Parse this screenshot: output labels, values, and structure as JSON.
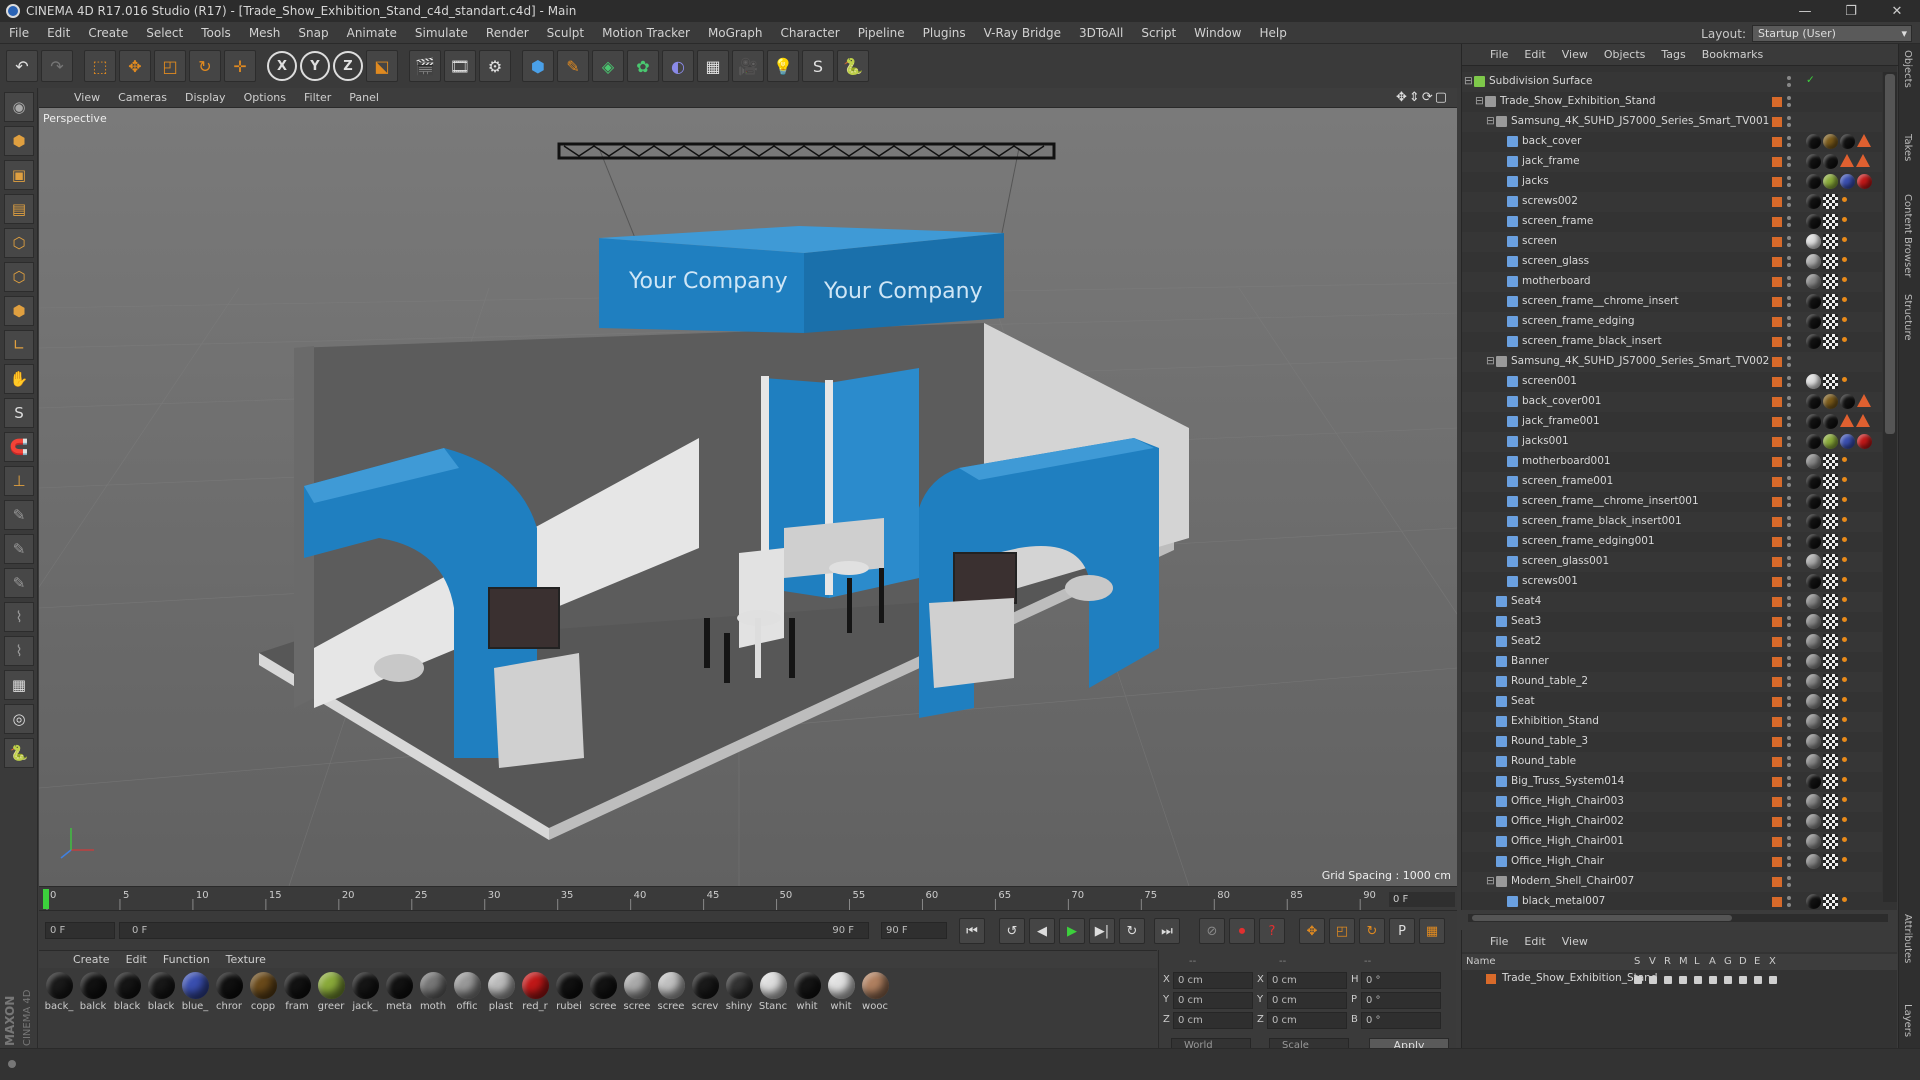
{
  "window": {
    "title": "CINEMA 4D R17.016 Studio (R17) - [Trade_Show_Exhibition_Stand_c4d_standart.c4d] - Main"
  },
  "menubar": [
    "File",
    "Edit",
    "Create",
    "Select",
    "Tools",
    "Mesh",
    "Snap",
    "Animate",
    "Simulate",
    "Render",
    "Sculpt",
    "Motion Tracker",
    "MoGraph",
    "Character",
    "Pipeline",
    "Plugins",
    "V-Ray Bridge",
    "3DToAll",
    "Script",
    "Window",
    "Help"
  ],
  "layout": {
    "label": "Layout:",
    "value": "Startup (User)"
  },
  "toolbar": {
    "icons": [
      "undo-icon",
      "redo-icon",
      "live-selection-icon",
      "move-icon",
      "scale-icon",
      "rotate-icon",
      "last-tool-icon",
      "x-axis-icon",
      "y-axis-icon",
      "z-axis-icon",
      "coordinate-system-icon",
      "render-view-icon",
      "render-picture-viewer-icon",
      "edit-render-settings-icon",
      "cube-icon",
      "pen-spline-icon",
      "subdivision-icon",
      "array-icon",
      "deformer-icon",
      "floor-icon",
      "camera-icon",
      "light-icon",
      "xpresso-icon",
      "python-icon"
    ],
    "axis_labels": [
      "X",
      "Y",
      "Z"
    ]
  },
  "viewport": {
    "menu": [
      "View",
      "Cameras",
      "Display",
      "Options",
      "Filter",
      "Panel"
    ],
    "label": "Perspective",
    "grid_spacing": "Grid Spacing : 1000 cm",
    "banner_text": "Your Company"
  },
  "timeline": {
    "ticks": [
      "0",
      "5",
      "10",
      "15",
      "20",
      "25",
      "30",
      "35",
      "40",
      "45",
      "50",
      "55",
      "60",
      "65",
      "70",
      "75",
      "80",
      "85",
      "90"
    ],
    "frame_end_field": "0 F"
  },
  "transport": {
    "current_frame": "0 F",
    "range_start": "0 F",
    "range_end": "90 F",
    "max_frame": "90 F"
  },
  "materials": {
    "menu": [
      "Create",
      "Edit",
      "Function",
      "Texture"
    ],
    "items": [
      {
        "name": "back_",
        "color": "#1a1a1a"
      },
      {
        "name": "balck",
        "color": "#111111"
      },
      {
        "name": "black",
        "color": "#151515"
      },
      {
        "name": "black",
        "color": "#181818"
      },
      {
        "name": "blue_",
        "color": "#3a4fb0"
      },
      {
        "name": "chror",
        "color": "#101010"
      },
      {
        "name": "copp",
        "color": "#6a4a1a"
      },
      {
        "name": "fram",
        "color": "#121212"
      },
      {
        "name": "greer",
        "color": "#8aaa3a"
      },
      {
        "name": "jack_",
        "color": "#151515"
      },
      {
        "name": "meta",
        "color": "#121212"
      },
      {
        "name": "moth",
        "color": "#777777"
      },
      {
        "name": "offic",
        "color": "#999999"
      },
      {
        "name": "plast",
        "color": "#bbbbbb"
      },
      {
        "name": "red_r",
        "color": "#c01818"
      },
      {
        "name": "rubei",
        "color": "#111111"
      },
      {
        "name": "scree",
        "color": "#131313"
      },
      {
        "name": "scree",
        "color": "#aaaaaa"
      },
      {
        "name": "scree",
        "color": "#c0c0c0"
      },
      {
        "name": "screv",
        "color": "#1a1a1a"
      },
      {
        "name": "shiny",
        "color": "#333333"
      },
      {
        "name": "Stanc",
        "color": "#dddddd"
      },
      {
        "name": "whit",
        "color": "#151515"
      },
      {
        "name": "whit",
        "color": "#e0e0e0"
      },
      {
        "name": "wooc",
        "color": "#b08060"
      }
    ]
  },
  "coords": {
    "header": [
      "--",
      "--",
      "--"
    ],
    "rows": [
      {
        "a": "X",
        "av": "0 cm",
        "b": "X",
        "bv": "0 cm",
        "c": "H",
        "cv": "0 °"
      },
      {
        "a": "Y",
        "av": "0 cm",
        "b": "Y",
        "bv": "0 cm",
        "c": "P",
        "cv": "0 °"
      },
      {
        "a": "Z",
        "av": "0 cm",
        "b": "Z",
        "bv": "0 cm",
        "c": "B",
        "cv": "0 °"
      }
    ],
    "mode": "World",
    "scale": "Scale",
    "apply": "Apply"
  },
  "objects": {
    "menu": [
      "File",
      "Edit",
      "View",
      "Objects",
      "Tags",
      "Bookmarks"
    ],
    "items": [
      {
        "name": "Subdivision Surface",
        "indent": 0,
        "icon": "#7ec84a",
        "tags": "sub"
      },
      {
        "name": "Trade_Show_Exhibition_Stand",
        "indent": 1,
        "icon": "#999",
        "tags": ""
      },
      {
        "name": "Samsung_4K_SUHD_JS7000_Series_Smart_TV001",
        "indent": 2,
        "icon": "#999",
        "tags": ""
      },
      {
        "name": "back_cover",
        "indent": 3,
        "icon": "#6aa0e0",
        "tags": "k,o,k,t"
      },
      {
        "name": "jack_frame",
        "indent": 3,
        "icon": "#6aa0e0",
        "tags": "k,k,t,t"
      },
      {
        "name": "jacks",
        "indent": 3,
        "icon": "#6aa0e0",
        "tags": "k,g,b,r"
      },
      {
        "name": "screws002",
        "indent": 3,
        "icon": "#6aa0e0",
        "tags": "k,c,p"
      },
      {
        "name": "screen_frame",
        "indent": 3,
        "icon": "#6aa0e0",
        "tags": "k,c,p"
      },
      {
        "name": "screen",
        "indent": 3,
        "icon": "#6aa0e0",
        "tags": "w,c,p"
      },
      {
        "name": "screen_glass",
        "indent": 3,
        "icon": "#6aa0e0",
        "tags": "s,c,p"
      },
      {
        "name": "motherboard",
        "indent": 3,
        "icon": "#6aa0e0",
        "tags": "m,c,p"
      },
      {
        "name": "screen_frame__chrome_insert",
        "indent": 3,
        "icon": "#6aa0e0",
        "tags": "k,c,p"
      },
      {
        "name": "screen_frame_edging",
        "indent": 3,
        "icon": "#6aa0e0",
        "tags": "k,c,p"
      },
      {
        "name": "screen_frame_black_insert",
        "indent": 3,
        "icon": "#6aa0e0",
        "tags": "k,c,p"
      },
      {
        "name": "Samsung_4K_SUHD_JS7000_Series_Smart_TV002",
        "indent": 2,
        "icon": "#999",
        "tags": ""
      },
      {
        "name": "screen001",
        "indent": 3,
        "icon": "#6aa0e0",
        "tags": "w,c,p"
      },
      {
        "name": "back_cover001",
        "indent": 3,
        "icon": "#6aa0e0",
        "tags": "k,o,k,t"
      },
      {
        "name": "jack_frame001",
        "indent": 3,
        "icon": "#6aa0e0",
        "tags": "k,k,t,t"
      },
      {
        "name": "jacks001",
        "indent": 3,
        "icon": "#6aa0e0",
        "tags": "k,g,b,r"
      },
      {
        "name": "motherboard001",
        "indent": 3,
        "icon": "#6aa0e0",
        "tags": "m,c,p"
      },
      {
        "name": "screen_frame001",
        "indent": 3,
        "icon": "#6aa0e0",
        "tags": "k,c,p"
      },
      {
        "name": "screen_frame__chrome_insert001",
        "indent": 3,
        "icon": "#6aa0e0",
        "tags": "k,c,p"
      },
      {
        "name": "screen_frame_black_insert001",
        "indent": 3,
        "icon": "#6aa0e0",
        "tags": "k,c,p"
      },
      {
        "name": "screen_frame_edging001",
        "indent": 3,
        "icon": "#6aa0e0",
        "tags": "k,c,p"
      },
      {
        "name": "screen_glass001",
        "indent": 3,
        "icon": "#6aa0e0",
        "tags": "s,c,p"
      },
      {
        "name": "screws001",
        "indent": 3,
        "icon": "#6aa0e0",
        "tags": "k,c,p"
      },
      {
        "name": "Seat4",
        "indent": 2,
        "icon": "#6aa0e0",
        "tags": "m,c,p"
      },
      {
        "name": "Seat3",
        "indent": 2,
        "icon": "#6aa0e0",
        "tags": "m,c,p"
      },
      {
        "name": "Seat2",
        "indent": 2,
        "icon": "#6aa0e0",
        "tags": "m,c,p"
      },
      {
        "name": "Banner",
        "indent": 2,
        "icon": "#6aa0e0",
        "tags": "m,c,p"
      },
      {
        "name": "Round_table_2",
        "indent": 2,
        "icon": "#6aa0e0",
        "tags": "m,c,p"
      },
      {
        "name": "Seat",
        "indent": 2,
        "icon": "#6aa0e0",
        "tags": "m,c,p"
      },
      {
        "name": "Exhibition_Stand",
        "indent": 2,
        "icon": "#6aa0e0",
        "tags": "m,c,p"
      },
      {
        "name": "Round_table_3",
        "indent": 2,
        "icon": "#6aa0e0",
        "tags": "m,c,p"
      },
      {
        "name": "Round_table",
        "indent": 2,
        "icon": "#6aa0e0",
        "tags": "m,c,p"
      },
      {
        "name": "Big_Truss_System014",
        "indent": 2,
        "icon": "#6aa0e0",
        "tags": "k,c,p"
      },
      {
        "name": "Office_High_Chair003",
        "indent": 2,
        "icon": "#6aa0e0",
        "tags": "m,c,p"
      },
      {
        "name": "Office_High_Chair002",
        "indent": 2,
        "icon": "#6aa0e0",
        "tags": "m,c,p"
      },
      {
        "name": "Office_High_Chair001",
        "indent": 2,
        "icon": "#6aa0e0",
        "tags": "m,c,p"
      },
      {
        "name": "Office_High_Chair",
        "indent": 2,
        "icon": "#6aa0e0",
        "tags": "m,c,p"
      },
      {
        "name": "Modern_Shell_Chair007",
        "indent": 2,
        "icon": "#999",
        "tags": ""
      },
      {
        "name": "black_metal007",
        "indent": 3,
        "icon": "#6aa0e0",
        "tags": "k,c,p"
      }
    ]
  },
  "layers": {
    "menu": [
      "File",
      "Edit",
      "View"
    ],
    "header_name": "Name",
    "flags": [
      "S",
      "V",
      "R",
      "M",
      "L",
      "A",
      "G",
      "D",
      "E",
      "X"
    ],
    "row": "Trade_Show_Exhibition_Stand"
  },
  "sidetabs": [
    "Objects",
    "Takes",
    "Content Browser",
    "Structure",
    "Attributes",
    "Layers"
  ],
  "brand": {
    "maxon": "MAXON",
    "product": "CINEMA 4D"
  },
  "colors": {
    "accent": "#e08a20",
    "banner": "#1f7fc0",
    "layer": "#d86a2a"
  }
}
